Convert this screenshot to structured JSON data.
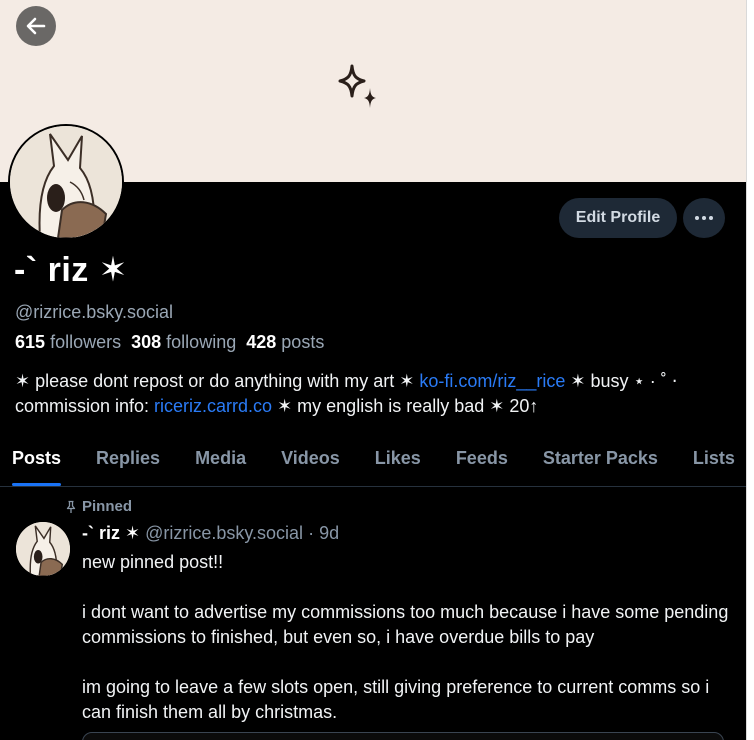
{
  "profile": {
    "display_name": "-` riz ✶",
    "handle": "@rizrice.bsky.social",
    "followers_count": "615",
    "followers_label": "followers",
    "following_count": "308",
    "following_label": "following",
    "posts_count": "428",
    "posts_label": "posts",
    "bio": {
      "p1": "✶ please dont repost or do anything with my art ✶ ",
      "link1": "ko-fi.com/riz__rice",
      "p2": " ✶ busy ⋆ · ˚ ⋅ commission info: ",
      "link2": "riceriz.carrd.co",
      "p3": " ✶ my english is really bad ✶ 20↑"
    }
  },
  "actions": {
    "edit_profile": "Edit Profile",
    "more": "···"
  },
  "tabs": [
    "Posts",
    "Replies",
    "Media",
    "Videos",
    "Likes",
    "Feeds",
    "Starter Packs",
    "Lists"
  ],
  "post": {
    "pinned_label": "Pinned",
    "author_name": "-` riz ✶",
    "author_handle": "@rizrice.bsky.social",
    "time": "· 9d",
    "paragraphs": [
      "new pinned post!!",
      "i dont want to advertise my commissions too much because i have some pending commissions to finished, but even so, i have overdue bills to pay",
      "im going to leave a few slots open, still giving preference to current comms so i can finish them all by christmas."
    ]
  },
  "colors": {
    "background": "#000000",
    "banner": "#f4ebe4",
    "link": "#2a7bf6",
    "muted": "#8896a6",
    "button_bg": "#1e2936",
    "tab_indicator": "#1a73f5"
  }
}
